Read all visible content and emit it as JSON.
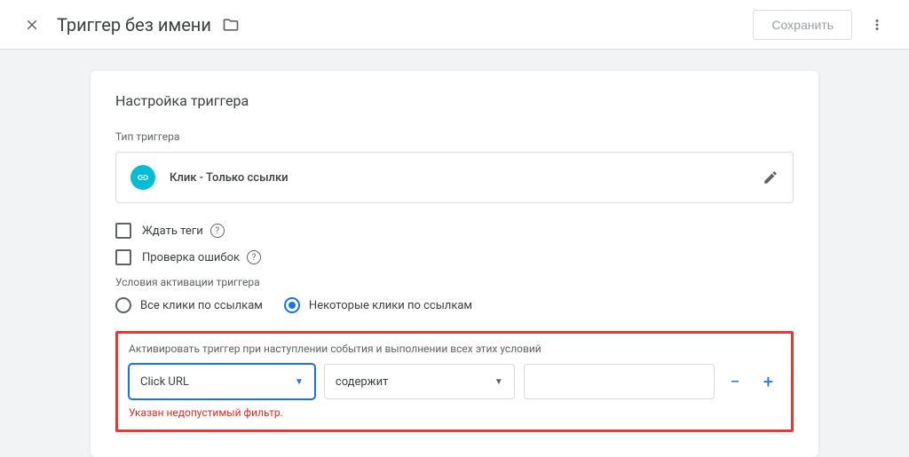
{
  "header": {
    "title": "Триггер без имени",
    "save_label": "Сохранить"
  },
  "card": {
    "title": "Настройка триггера",
    "trigger_type_label": "Тип триггера",
    "trigger_type_value": "Клик - Только ссылки",
    "wait_tags_label": "Ждать теги",
    "check_errors_label": "Проверка ошибок",
    "activation_conditions_label": "Условия активации триггера",
    "radio_all_label": "Все клики по ссылкам",
    "radio_some_label": "Некоторые клики по ссылкам",
    "condition_instruction": "Активировать триггер при наступлении события и выполнении всех этих условий",
    "variable_value": "Click URL",
    "operator_value": "содержит",
    "error_message": "Указан недопустимый фильтр."
  }
}
